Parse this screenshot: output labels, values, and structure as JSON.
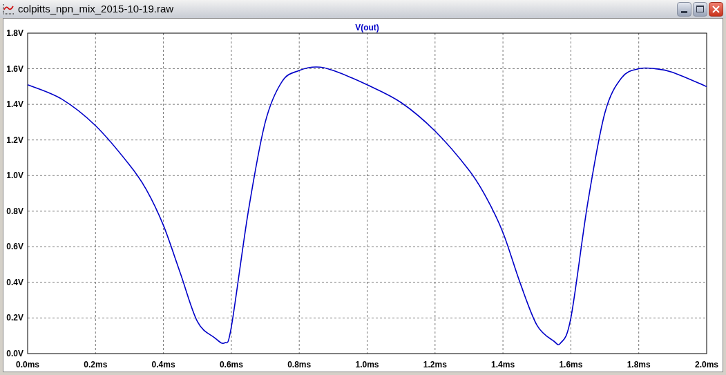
{
  "window": {
    "title": "colpitts_npn_mix_2015-10-19.raw"
  },
  "plot": {
    "chart_data": {
      "type": "line",
      "grid": true,
      "x": [
        0,
        0.1,
        0.2,
        0.3,
        0.35,
        0.4,
        0.45,
        0.5,
        0.55,
        0.58,
        0.6,
        0.65,
        0.7,
        0.75,
        0.8,
        0.85,
        0.9,
        1.0,
        1.1,
        1.2,
        1.3,
        1.35,
        1.4,
        1.45,
        1.5,
        1.55,
        1.57,
        1.6,
        1.65,
        1.7,
        1.75,
        1.8,
        1.85,
        1.9,
        2.0
      ],
      "series": [
        {
          "name": "V(out)",
          "color": "#0000c8",
          "values": [
            1.51,
            1.43,
            1.28,
            1.06,
            0.92,
            0.72,
            0.45,
            0.18,
            0.09,
            0.06,
            0.15,
            0.8,
            1.3,
            1.53,
            1.59,
            1.61,
            1.59,
            1.51,
            1.41,
            1.25,
            1.03,
            0.88,
            0.68,
            0.4,
            0.16,
            0.07,
            0.06,
            0.2,
            0.85,
            1.35,
            1.55,
            1.6,
            1.6,
            1.58,
            1.5
          ]
        }
      ],
      "xlim": [
        0,
        2
      ],
      "ylim": [
        0,
        1.8
      ],
      "xticks": [
        {
          "value": 0,
          "label": "0.0ms"
        },
        {
          "value": 0.2,
          "label": "0.2ms"
        },
        {
          "value": 0.4,
          "label": "0.4ms"
        },
        {
          "value": 0.6,
          "label": "0.6ms"
        },
        {
          "value": 0.8,
          "label": "0.8ms"
        },
        {
          "value": 1.0,
          "label": "1.0ms"
        },
        {
          "value": 1.2,
          "label": "1.2ms"
        },
        {
          "value": 1.4,
          "label": "1.4ms"
        },
        {
          "value": 1.6,
          "label": "1.6ms"
        },
        {
          "value": 1.8,
          "label": "1.8ms"
        },
        {
          "value": 2.0,
          "label": "2.0ms"
        }
      ],
      "yticks": [
        {
          "value": 0,
          "label": "0.0V"
        },
        {
          "value": 0.2,
          "label": "0.2V"
        },
        {
          "value": 0.4,
          "label": "0.4V"
        },
        {
          "value": 0.6,
          "label": "0.6V"
        },
        {
          "value": 0.8,
          "label": "0.8V"
        },
        {
          "value": 1.0,
          "label": "1.0V"
        },
        {
          "value": 1.2,
          "label": "1.2V"
        },
        {
          "value": 1.4,
          "label": "1.4V"
        },
        {
          "value": 1.6,
          "label": "1.6V"
        },
        {
          "value": 1.8,
          "label": "1.8V"
        }
      ]
    }
  }
}
